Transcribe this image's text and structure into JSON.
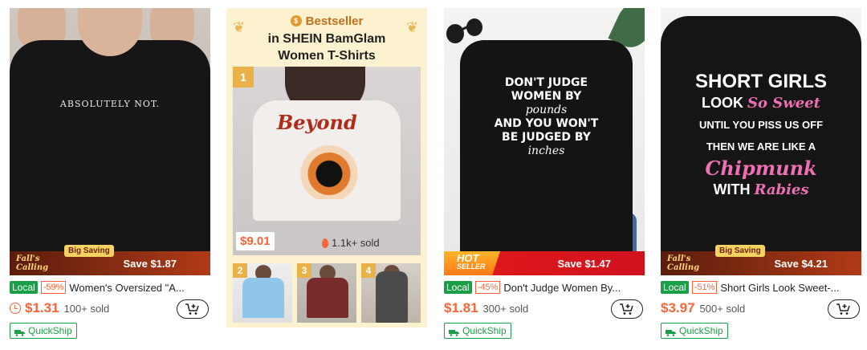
{
  "products": [
    {
      "shirt_text": "ABSOLUTELY NOT.",
      "promo_badge": "Fall's Calling",
      "promo_tag": "Big Saving",
      "save_label": "Save $1.87",
      "local_tag": "Local",
      "discount": "-59%",
      "title": "Women's Oversized \"A...",
      "price": "$1.31",
      "sold": "100+ sold",
      "quickship": "QuickShip"
    },
    {
      "shirt_lines": [
        "DON'T JUDGE",
        "WOMEN BY",
        "pounds",
        "AND YOU WON'T",
        "BE JUDGED BY",
        "inches"
      ],
      "hot_line1": "HOT",
      "hot_line2": "SELLER",
      "save_label": "Save $1.47",
      "local_tag": "Local",
      "discount": "-45%",
      "title": "Don't Judge Women By...",
      "price": "$1.81",
      "sold": "300+ sold",
      "quickship": "QuickShip"
    },
    {
      "shirt_lines": [
        "SHORT GIRLS",
        "LOOK",
        "So Sweet",
        "UNTIL YOU PISS US OFF",
        "THEN WE ARE LIKE A",
        "Chipmunk",
        "WITH",
        "Rabies"
      ],
      "promo_badge": "Fall's Calling",
      "promo_tag": "Big Saving",
      "save_label": "Save $4.21",
      "local_tag": "Local",
      "discount": "-51%",
      "title": "Short Girls Look Sweet-...",
      "price": "$3.97",
      "sold": "500+ sold",
      "quickship": "QuickShip"
    }
  ],
  "bestseller": {
    "label": "Bestseller",
    "title_line1": "in SHEIN BamGlam",
    "title_line2": "Women T-Shirts",
    "main_rank": "1",
    "main_print": "Beyond",
    "price": "$9.01",
    "sold": "1.1k+ sold",
    "thumb_ranks": [
      "2",
      "3",
      "4"
    ]
  },
  "colors": {
    "accent": "#fa6338",
    "local_green": "#1a9e47",
    "bestseller_bg": "#fcf2cf",
    "hot_red": "#e21a1a"
  }
}
